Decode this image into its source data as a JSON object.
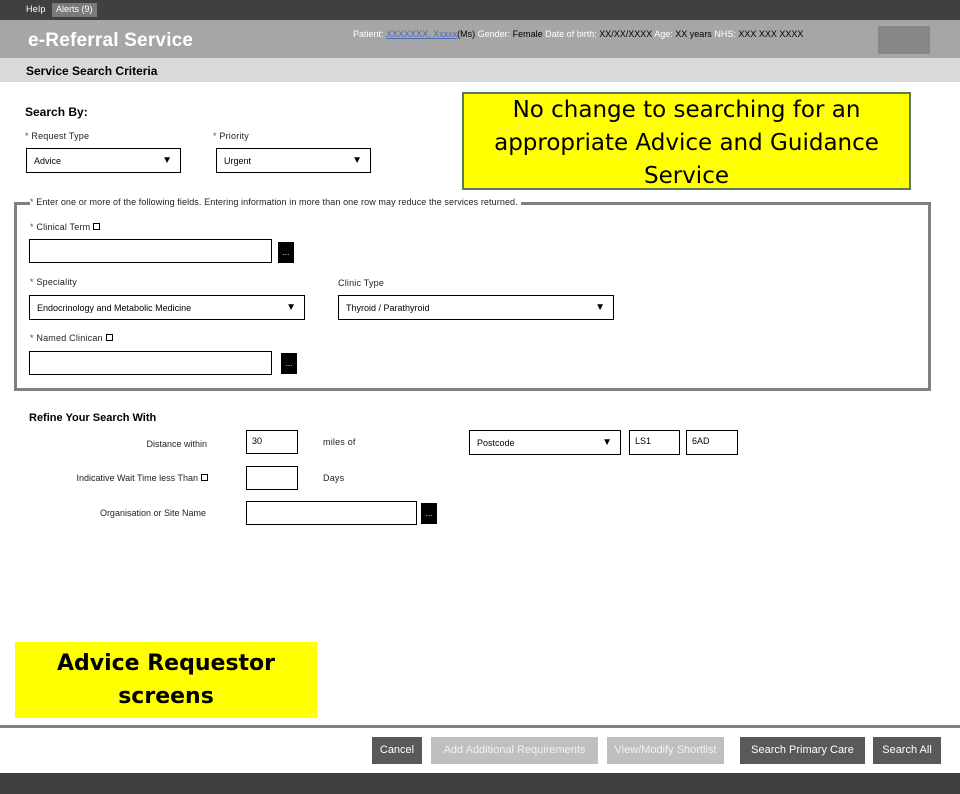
{
  "topbar": {
    "help_label": "Help",
    "alerts_label": "Alerts (9)"
  },
  "header": {
    "title": "e-Referral Service",
    "patient_label": "Patient:",
    "patient_name": "XXXXXXX, Xxxxx",
    "patient_title": "(Ms)",
    "gender_label": "Gender:",
    "gender_value": "Female",
    "dob_label": "Date of birth:",
    "dob_value": "XX/XX/XXXX",
    "age_label": "Age:",
    "age_value": "XX years",
    "nhs_label": "NHS:",
    "nhs_value": "XXX XXX XXXX"
  },
  "subheader": {
    "title": "Service Search Criteria"
  },
  "search_by": {
    "heading": "Search By:",
    "request_type": {
      "label": "Request Type",
      "value": "Advice"
    },
    "priority": {
      "label": "Priority",
      "value": "Urgent"
    }
  },
  "fields": {
    "legend": "Enter one or more of the following fields. Entering information in more than one row may reduce the services returned.",
    "clinical_term": {
      "label": "Clinical Term",
      "value": ""
    },
    "speciality": {
      "label": "Speciality",
      "value": "Endocrinology and Metabolic Medicine"
    },
    "clinic_type": {
      "label": "Clinic Type",
      "value": "Thyroid / Parathyroid"
    },
    "named_clinician": {
      "label": "Named Clinican",
      "value": ""
    },
    "lookup_label": "..."
  },
  "refine": {
    "heading": "Refine Your Search With",
    "distance_label": "Distance within",
    "distance_value": "30",
    "miles_of_label": "miles of",
    "location_type": "Postcode",
    "postcode_part1": "LS1",
    "postcode_part2": "6AD",
    "wait_time_label": "Indicative Wait Time less Than",
    "wait_time_value": "",
    "days_label": "Days",
    "org_label": "Organisation or Site Name",
    "org_value": ""
  },
  "callouts": {
    "top": "No change to searching for an appropriate Advice and Guidance Service",
    "bottom": "Advice Requestor screens"
  },
  "buttons": {
    "cancel": "Cancel",
    "add_requirements": "Add Additional Requirements",
    "view_shortlist": "View/Modify Shortlist",
    "search_primary": "Search Primary Care",
    "search_all": "Search All"
  },
  "icons": {
    "dropdown_arrow": "▼",
    "required_marker": "*"
  }
}
